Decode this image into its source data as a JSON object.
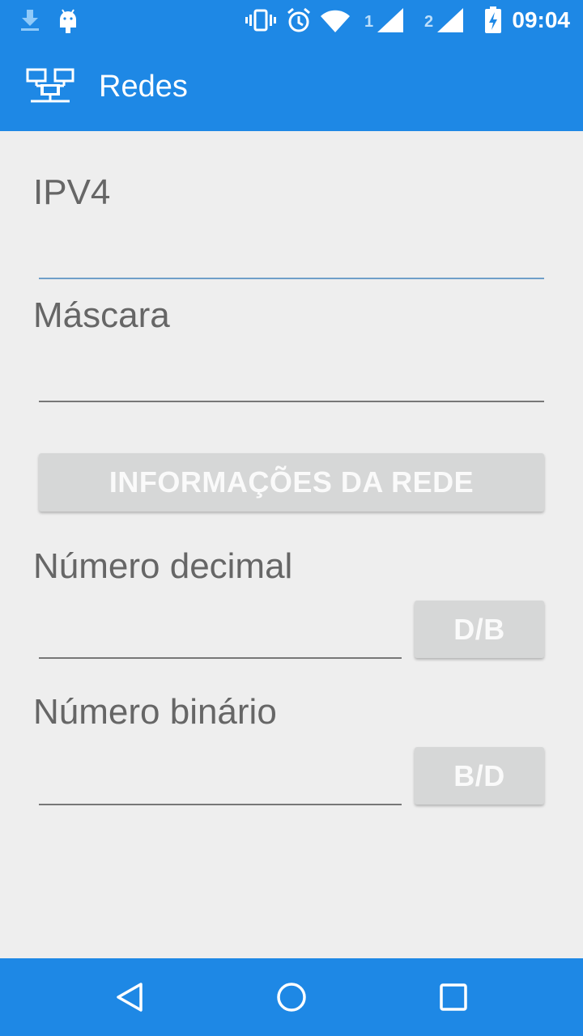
{
  "status_bar": {
    "time": "09:04",
    "sim1_label": "1",
    "sim2_label": "2",
    "icons": [
      "download-icon",
      "android-icon",
      "vibrate-icon",
      "alarm-icon",
      "wifi-icon",
      "signal-icon",
      "battery-charging-icon"
    ]
  },
  "toolbar": {
    "title": "Redes",
    "icon": "network-icon"
  },
  "form": {
    "ipv4_label": "IPV4",
    "ipv4_value": "",
    "mask_label": "Máscara",
    "mask_value": "",
    "network_info_button": "INFORMAÇÕES DA REDE",
    "decimal_label": "Número decimal",
    "decimal_value": "",
    "db_button": "D/B",
    "binary_label": "Número binário",
    "binary_value": "",
    "bd_button": "B/D"
  },
  "nav": {
    "icons": [
      "back-icon",
      "home-icon",
      "recents-icon"
    ]
  },
  "colors": {
    "primary": "#1e88e5",
    "background": "#eeeeee",
    "button": "#d6d7d7",
    "label": "#666666"
  }
}
